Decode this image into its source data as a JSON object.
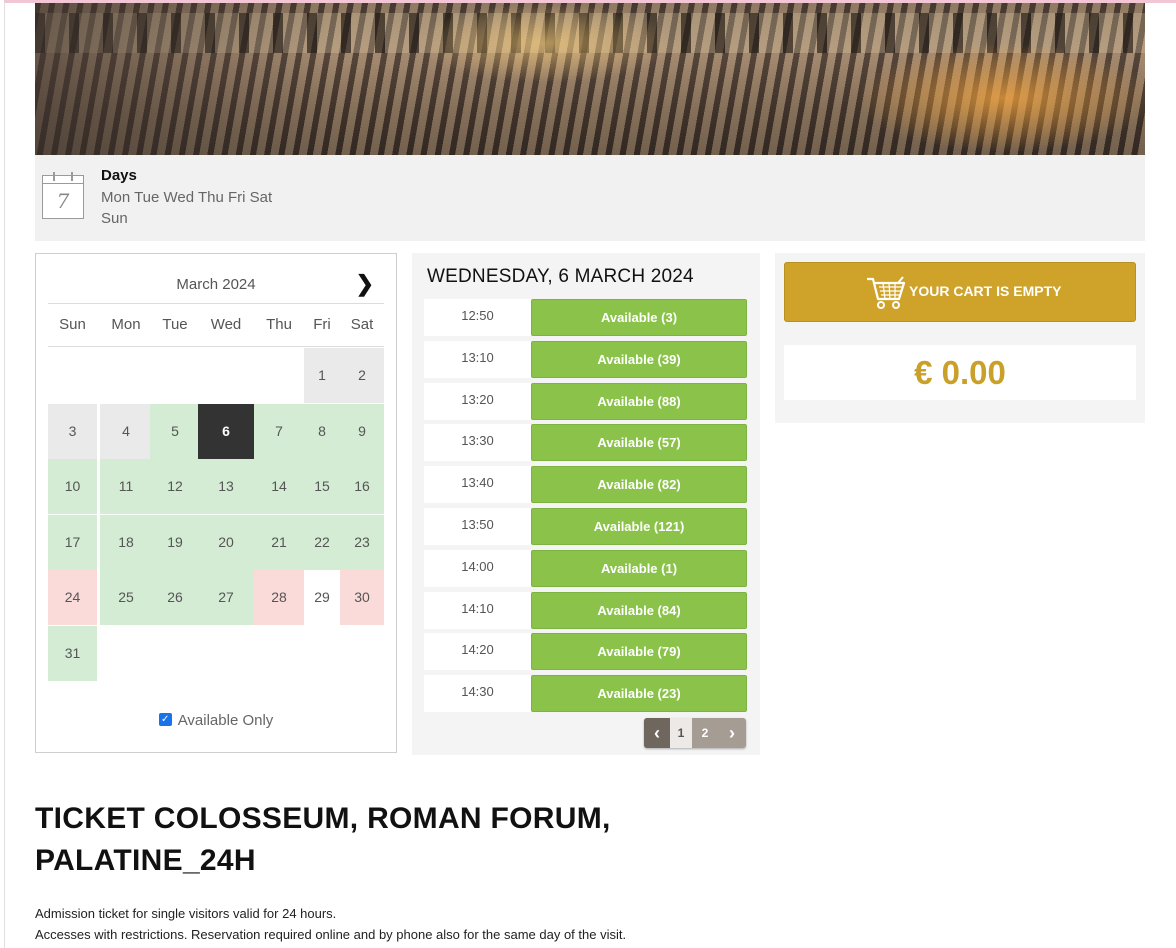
{
  "days": {
    "title": "Days",
    "icon_number": "7",
    "list": "Mon Tue Wed Thu Fri Sat Sun"
  },
  "calendar": {
    "month_label": "March 2024",
    "next_label": "›",
    "weekdays": [
      "Sun",
      "Mon",
      "Tue",
      "Wed",
      "Thu",
      "Fri",
      "Sat"
    ],
    "days": [
      {
        "n": "1",
        "state": "gray"
      },
      {
        "n": "2",
        "state": "gray"
      },
      {
        "n": "3",
        "state": "gray"
      },
      {
        "n": "4",
        "state": "gray"
      },
      {
        "n": "5",
        "state": "green"
      },
      {
        "n": "6",
        "state": "selected"
      },
      {
        "n": "7",
        "state": "green"
      },
      {
        "n": "8",
        "state": "green"
      },
      {
        "n": "9",
        "state": "green"
      },
      {
        "n": "10",
        "state": "green"
      },
      {
        "n": "11",
        "state": "green"
      },
      {
        "n": "12",
        "state": "green"
      },
      {
        "n": "13",
        "state": "green"
      },
      {
        "n": "14",
        "state": "green"
      },
      {
        "n": "15",
        "state": "green"
      },
      {
        "n": "16",
        "state": "green"
      },
      {
        "n": "17",
        "state": "green"
      },
      {
        "n": "18",
        "state": "green"
      },
      {
        "n": "19",
        "state": "green"
      },
      {
        "n": "20",
        "state": "green"
      },
      {
        "n": "21",
        "state": "green"
      },
      {
        "n": "22",
        "state": "green"
      },
      {
        "n": "23",
        "state": "green"
      },
      {
        "n": "24",
        "state": "red"
      },
      {
        "n": "25",
        "state": "green"
      },
      {
        "n": "26",
        "state": "green"
      },
      {
        "n": "27",
        "state": "green"
      },
      {
        "n": "28",
        "state": "red"
      },
      {
        "n": "29",
        "state": "white"
      },
      {
        "n": "30",
        "state": "red"
      },
      {
        "n": "31",
        "state": "green"
      }
    ],
    "available_only_label": "Available Only",
    "available_only_checked": true
  },
  "slots": {
    "title": "WEDNESDAY, 6 MARCH 2024",
    "items": [
      {
        "time": "12:50",
        "label": "Available (3)"
      },
      {
        "time": "13:10",
        "label": "Available (39)"
      },
      {
        "time": "13:20",
        "label": "Available (88)"
      },
      {
        "time": "13:30",
        "label": "Available (57)"
      },
      {
        "time": "13:40",
        "label": "Available (82)"
      },
      {
        "time": "13:50",
        "label": "Available (121)"
      },
      {
        "time": "14:00",
        "label": "Available (1)"
      },
      {
        "time": "14:10",
        "label": "Available (84)"
      },
      {
        "time": "14:20",
        "label": "Available (79)"
      },
      {
        "time": "14:30",
        "label": "Available (23)"
      }
    ],
    "pager": {
      "prev": "‹",
      "page1": "1",
      "page2": "2",
      "next": "›"
    }
  },
  "cart": {
    "label": "YOUR CART IS EMPTY",
    "total": "€ 0.00",
    "accent_color": "#cfa22a"
  },
  "product": {
    "title_line1": "TICKET COLOSSEUM, ROMAN FORUM,",
    "title_line2": "PALATINE_24H",
    "desc_line1": "Admission ticket for single visitors valid for 24 hours.",
    "desc_line2": "Accesses with restrictions. Reservation required online and by phone also for the same day of the visit."
  }
}
